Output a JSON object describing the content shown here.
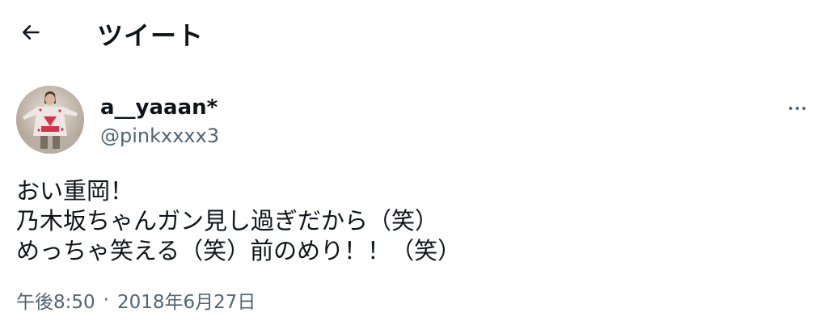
{
  "header": {
    "back_icon": "arrow-left-icon",
    "title": "ツイート"
  },
  "author": {
    "display_name": "a__yaaan*",
    "handle": "@pinkxxxx3",
    "more_icon": "more-horizontal-icon"
  },
  "tweet": {
    "lines": [
      "おい重岡！",
      "乃木坂ちゃんガン見し過ぎだから（笑）",
      "めっちゃ笑える（笑）前のめり！！（笑）"
    ]
  },
  "meta": {
    "time": "午後8:50",
    "separator": "·",
    "date": "2018年6月27日"
  },
  "colors": {
    "text_primary": "#0f1419",
    "text_secondary": "#536471",
    "background": "#ffffff"
  }
}
